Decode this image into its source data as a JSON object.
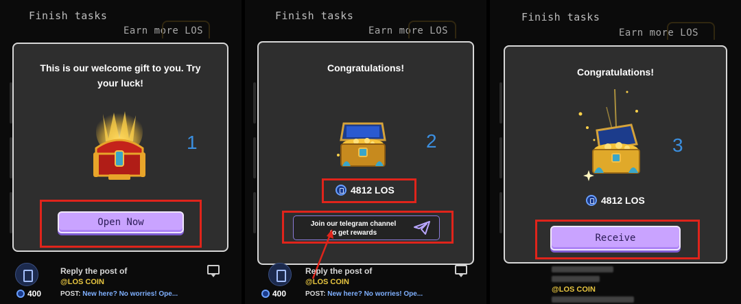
{
  "screens": [
    {
      "header_title": "Finish tasks",
      "header_subtitle": "Earn more LOS",
      "modal_title": "This is our welcome gift to you. Try your luck!",
      "step_number": "1",
      "button_label": "Open Now",
      "post": {
        "title": "Reply the post of",
        "handle": "@LOS COIN",
        "reward": "400",
        "post_label": "POST:",
        "post_text": "New here? No worries! Ope..."
      }
    },
    {
      "header_title": "Finish tasks",
      "header_subtitle": "Earn more LOS",
      "modal_title": "Congratulations!",
      "step_number": "2",
      "amount": "4812 LOS",
      "telegram_label_line1": "Join our telegram channel",
      "telegram_label_line2": "to get rewards",
      "post": {
        "title": "Reply the post of",
        "handle": "@LOS COIN",
        "reward": "400",
        "post_label": "POST:",
        "post_text": "New here? No worries! Ope..."
      }
    },
    {
      "header_title": "Finish tasks",
      "header_subtitle": "Earn more LOS",
      "modal_title": "Congratulations!",
      "step_number": "3",
      "amount": "4812 LOS",
      "button_label": "Receive",
      "post": {
        "handle": "@LOS COIN"
      }
    }
  ],
  "icons": {
    "los_coin": "los-coin-icon",
    "telegram": "telegram-plane-icon",
    "chest": "treasure-chest-icon",
    "comment": "comment-icon"
  },
  "colors": {
    "highlight_red": "#e0241b",
    "button_purple": "#c9a3ff",
    "step_blue": "#3b8fe0",
    "modal_bg": "#2e2e2e"
  }
}
